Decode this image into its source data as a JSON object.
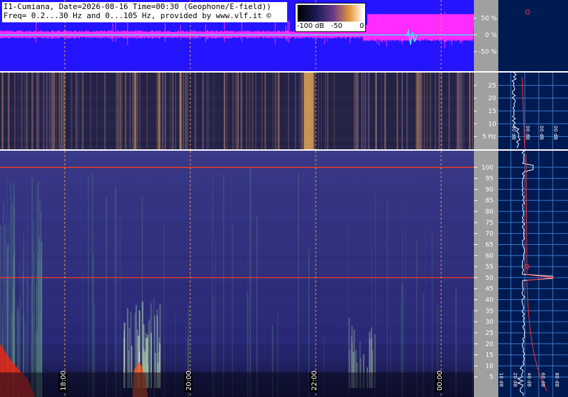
{
  "header": {
    "line1": "I1-Cumiana, Date=2026-08-16 Time=00:30 (Geophone/E-field))",
    "line2": "Freq= 0.2...30 Hz and 0...105 Hz, provided by www.vlf.it ©"
  },
  "colorbar": {
    "labels": [
      "-100 dB",
      "-50",
      "0"
    ]
  },
  "colors": {
    "waveform_bg": "#2414ff",
    "waveform_trace": "#ff2bff",
    "zero_line": "#45e0ff",
    "spectrogram_dark": "#14143a",
    "side_panel": "#001a52",
    "side_grid": "#3a78c8",
    "marker_line": "#ff3a1a",
    "axis_bg": "#a0a0a0"
  },
  "chart_data": [
    {
      "type": "line",
      "panel": "waveform",
      "ylabel_ticks": [
        "50 %",
        "0 %",
        "-50 %"
      ],
      "ylim": [
        -100,
        100
      ]
    },
    {
      "type": "heatmap",
      "panel": "low-frequency spectrogram",
      "freq_ticks": [
        "25",
        "20",
        "15",
        "10",
        "5 Hz"
      ],
      "ylim": [
        0,
        30
      ],
      "side_ticks": [
        "00 dB",
        "00 dB",
        "00 dB",
        "00 dB"
      ],
      "bursts": [
        {
          "time": "21:45",
          "strength": 0.95
        },
        {
          "time": "19:08",
          "strength": 0.5
        },
        {
          "time": "19:30",
          "strength": 0.45
        },
        {
          "time": "19:50",
          "strength": 0.55
        },
        {
          "time": "23:30",
          "strength": 0.35
        }
      ]
    },
    {
      "type": "heatmap",
      "panel": "high-frequency spectrogram",
      "freq_ticks": [
        "100",
        "95",
        "90",
        "85",
        "80",
        "75",
        "70",
        "65",
        "60",
        "55",
        "50",
        "45",
        "40",
        "35",
        "30",
        "25",
        "20",
        "15",
        "10",
        "5"
      ],
      "ylim": [
        0,
        105
      ],
      "time_labels": [
        "18:00",
        "20:00",
        "22:00",
        "00:00"
      ],
      "side_ticks": [
        "10 dB",
        "20 dB",
        "40 dB",
        "60 dB",
        "80 dB"
      ],
      "marker_lines_hz": [
        50,
        100
      ]
    }
  ]
}
